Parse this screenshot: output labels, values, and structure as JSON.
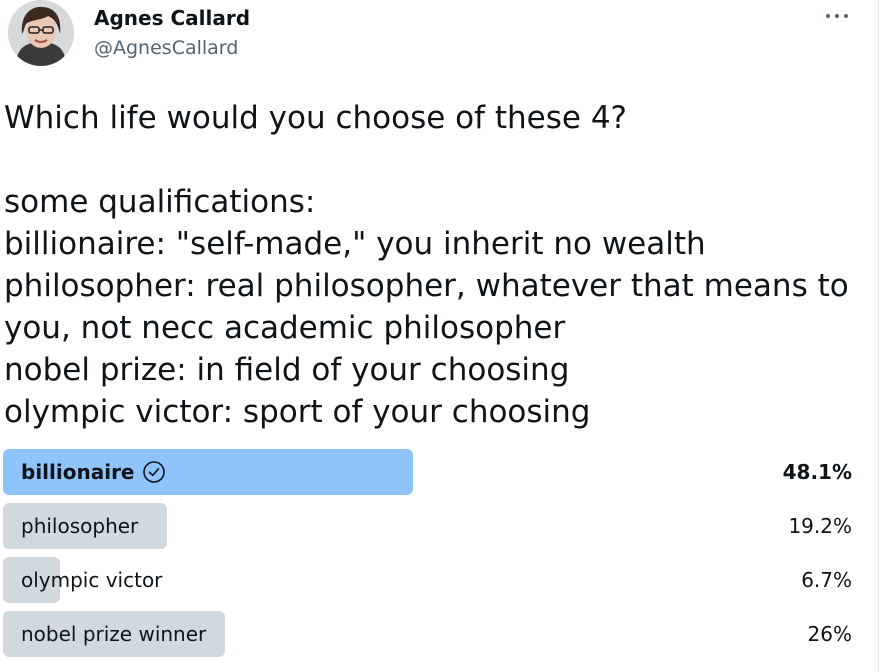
{
  "user": {
    "name": "Agnes Callard",
    "handle": "@AgnesCallard"
  },
  "tweet": {
    "text": "Which life would you choose of these 4?\n\nsome qualifications:\nbillionaire: \"self-made,\" you inherit no wealth\nphilosopher: real philosopher, whatever that means to you, not necc academic philosopher\nnobel prize: in field of your choosing\nolympic victor: sport of your choosing"
  },
  "poll": {
    "options": [
      {
        "label": "billionaire",
        "percent_text": "48.1%",
        "percent": 48.1,
        "winner": true
      },
      {
        "label": "philosopher",
        "percent_text": "19.2%",
        "percent": 19.2,
        "winner": false
      },
      {
        "label": "olympic victor",
        "percent_text": "6.7%",
        "percent": 6.7,
        "winner": false
      },
      {
        "label": "nobel prize winner",
        "percent_text": "26%",
        "percent": 26,
        "winner": false
      }
    ]
  },
  "icons": {
    "more": "more-horizontal-icon",
    "winner_check": "check-circle-icon"
  },
  "colors": {
    "winner_bar": "#8ec3fb",
    "loser_bar": "#cfd9de",
    "handle_text": "#536471"
  }
}
